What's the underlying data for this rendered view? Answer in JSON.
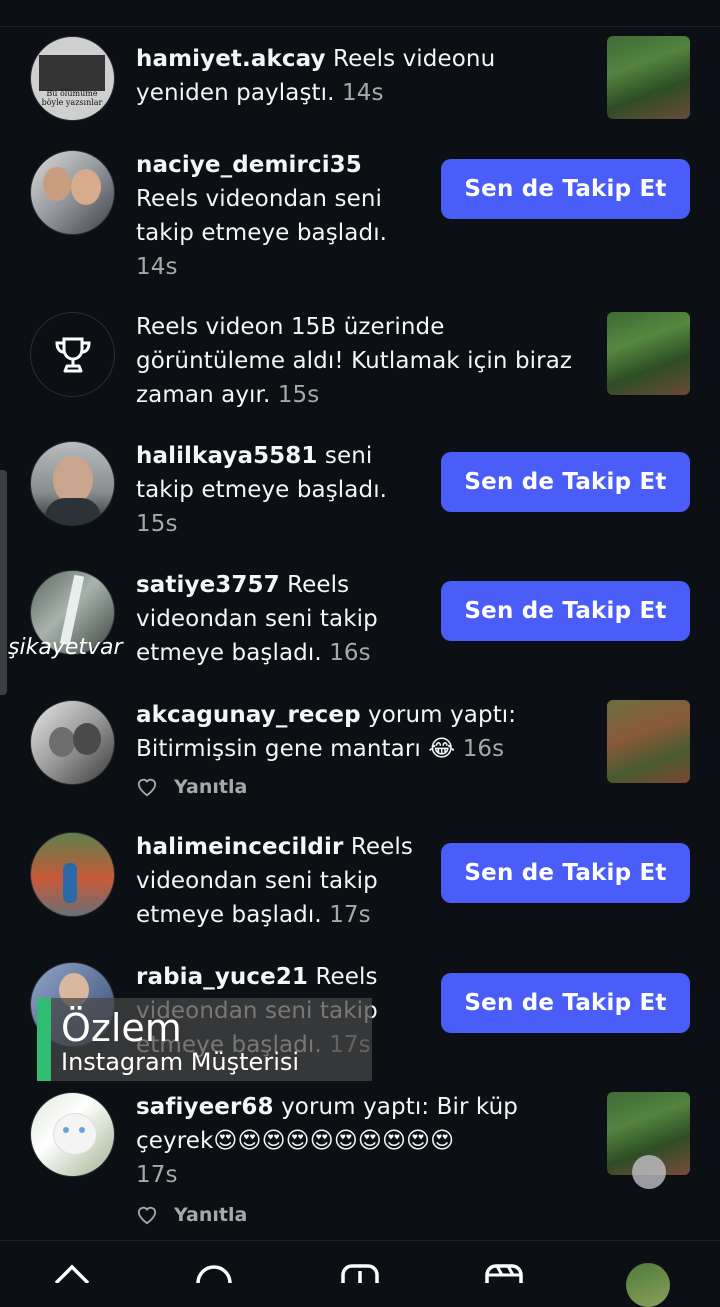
{
  "notifications": [
    {
      "username": "hamiyet.akcay",
      "message": " Reels videonu yeniden paylaştı.",
      "time": "14s",
      "avatar_text": "Bu ölümüme böyle yazsınlar"
    },
    {
      "username": "naciye_demirci35",
      "message": "Reels videondan seni takip etmeye başladı.",
      "time": "14s",
      "button": "Sen de Takip Et"
    },
    {
      "message": "Reels videon 15B üzerinde görüntüleme aldı! Kutlamak için biraz zaman ayır.",
      "time": "15s",
      "icon": "trophy-icon"
    },
    {
      "username": "halilkaya5581",
      "message": " seni takip etmeye başladı.",
      "time": "15s",
      "button": "Sen de Takip Et"
    },
    {
      "username": "satiye3757",
      "message": " Reels videondan seni takip etmeye başladı.",
      "time": "16s",
      "button": "Sen de Takip Et"
    },
    {
      "username": "akcagunay_recep",
      "message": " yorum yaptı: Bitirmişsin gene mantarı 😂",
      "time": "16s",
      "reply": "Yanıtla"
    },
    {
      "username": "halimeincecildir",
      "message": " Reels videondan seni takip etmeye başladı.",
      "time": "17s",
      "button": "Sen de Takip Et"
    },
    {
      "username": "rabia_yuce21",
      "message": " Reels videondan seni takip etmeye başladı.",
      "time": "17s",
      "button": "Sen de Takip Et"
    },
    {
      "username": "safiyeer68",
      "message": " yorum yaptı: Bir küp çeyrek😍😍😍😍😍😍😍😍😍😍",
      "time": "17s",
      "reply": "Yanıtla"
    }
  ],
  "watermark": "şikayetvar",
  "overlay": {
    "name": "Özlem",
    "role": "Instagram Müşterisi"
  },
  "colors": {
    "background": "#0c1014",
    "button": "#4a5df9",
    "overlay_accent": "#2fbd74"
  }
}
